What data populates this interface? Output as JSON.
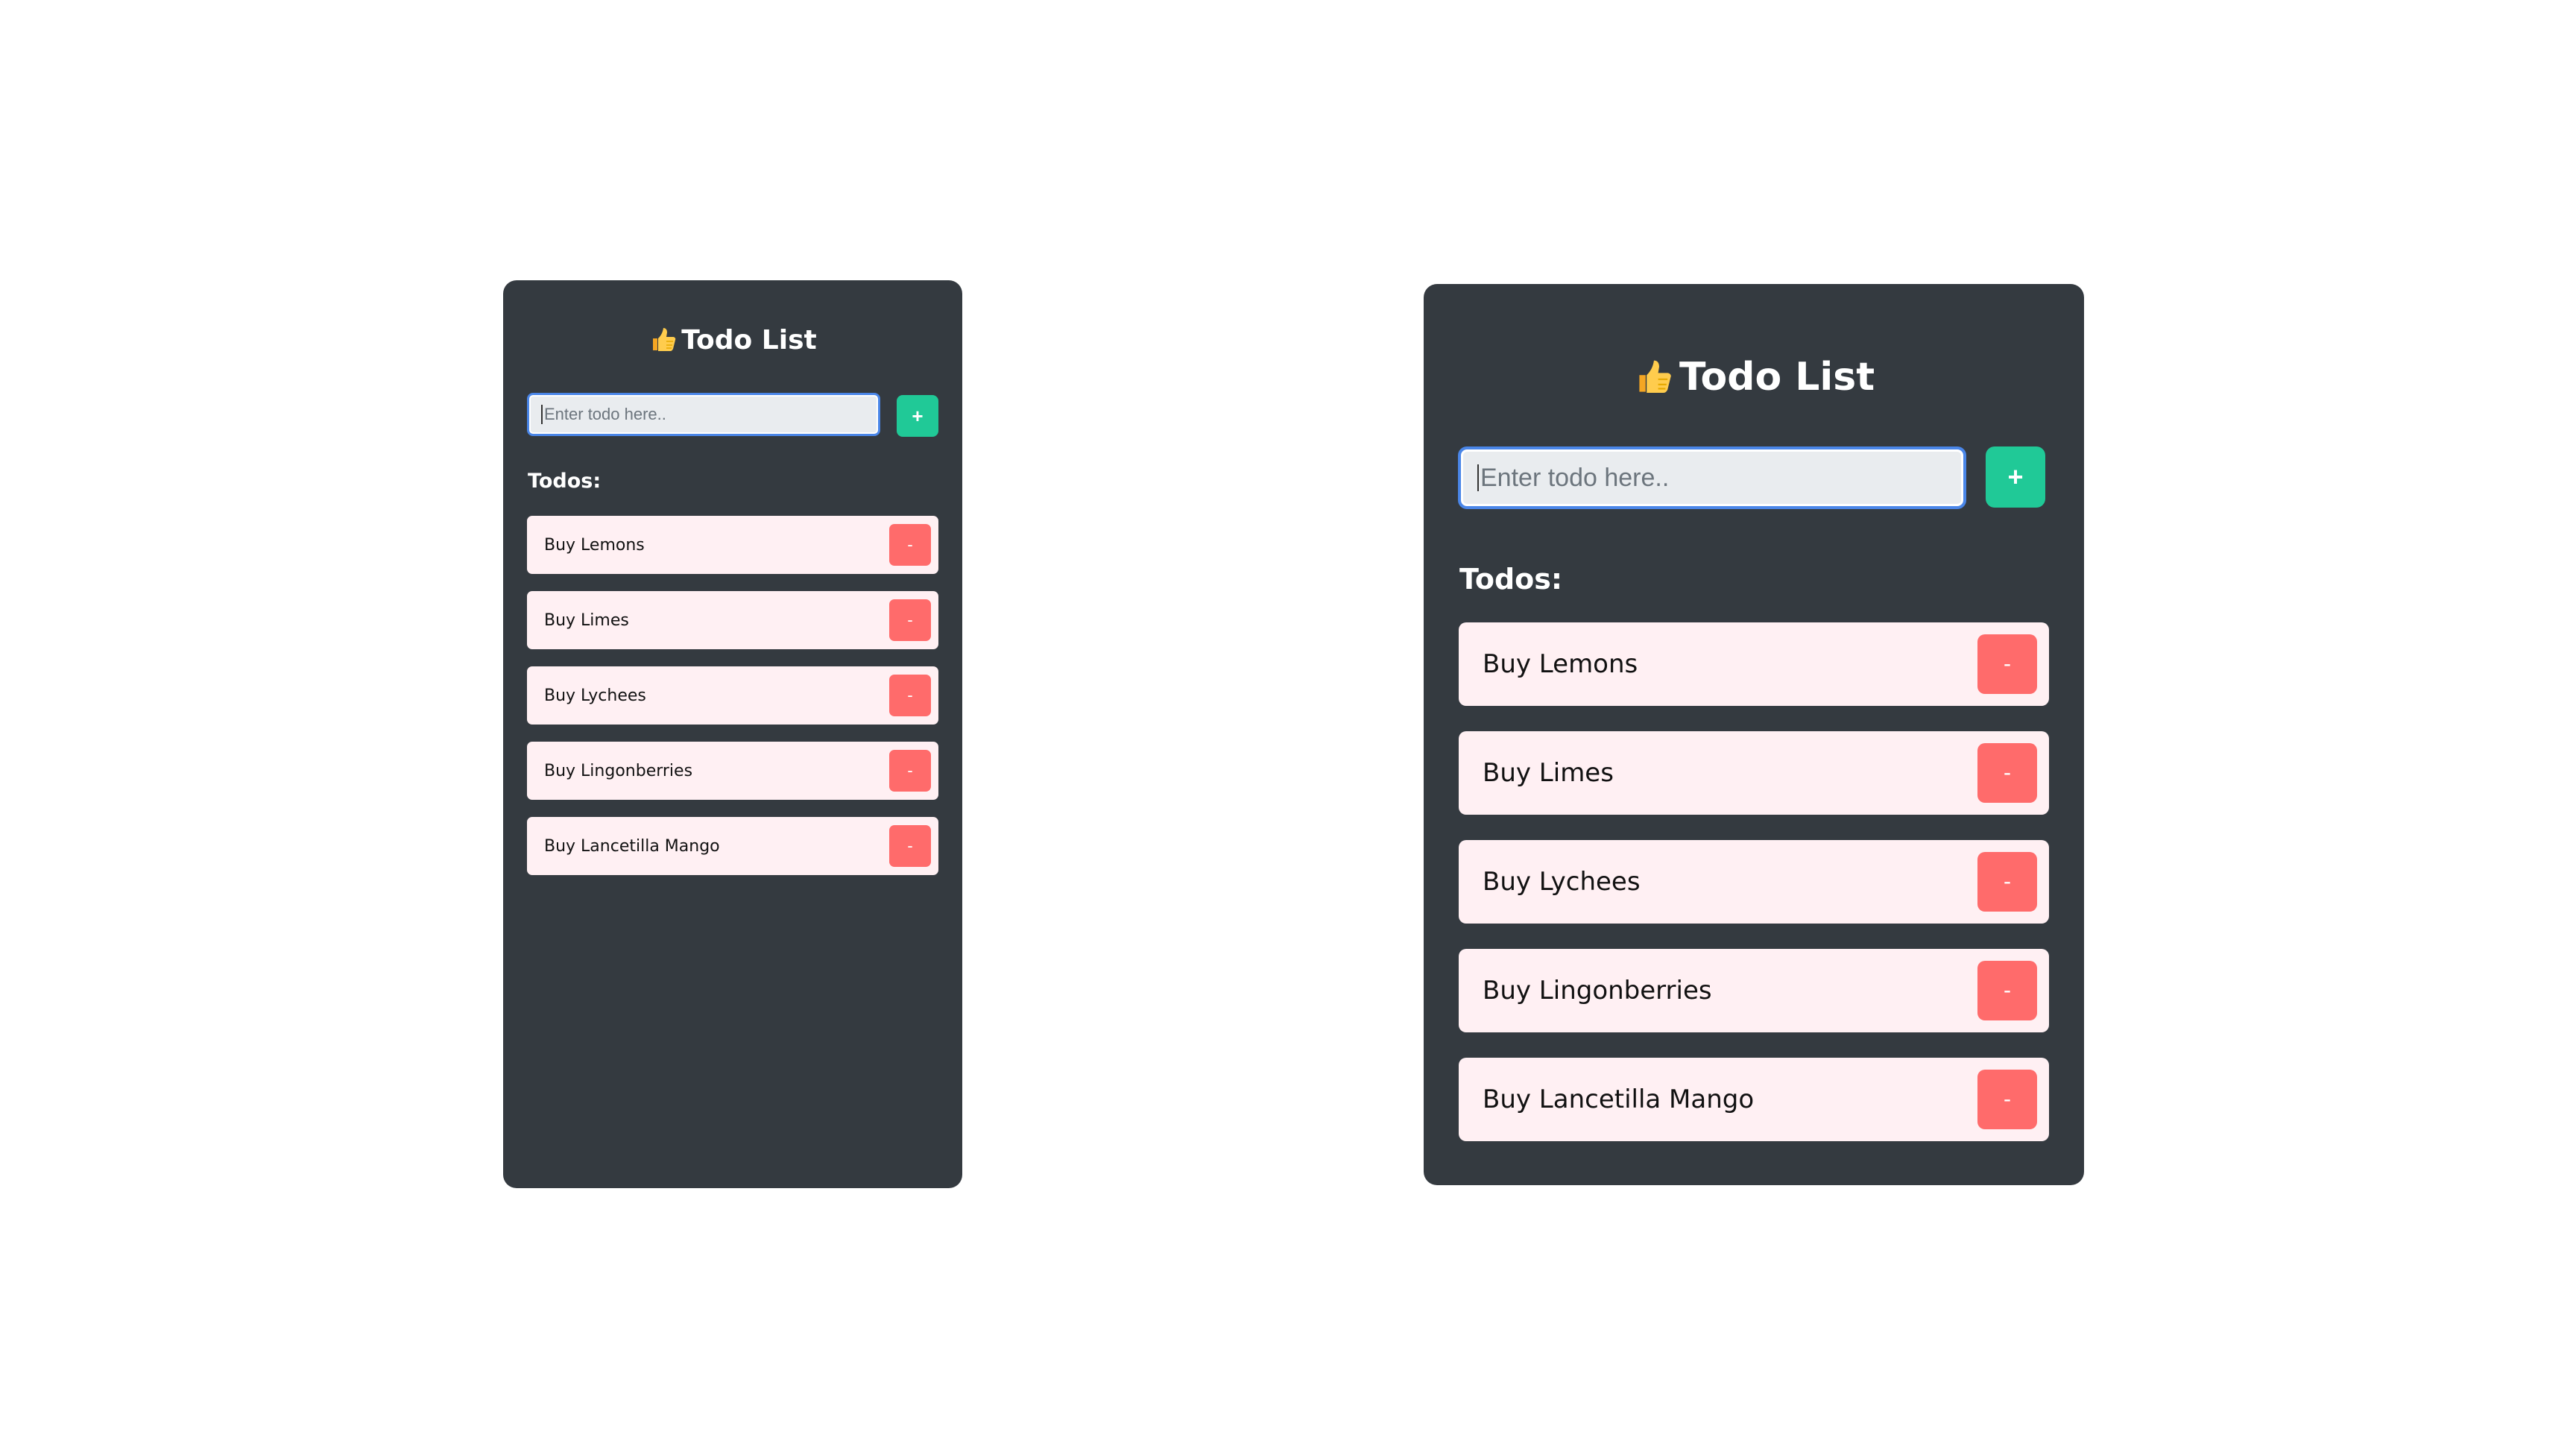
{
  "app": {
    "title": "Todo List",
    "title_icon": "thumbs-up-icon"
  },
  "form": {
    "placeholder": "Enter todo here..",
    "add_label": "+"
  },
  "todos_heading": "Todos:",
  "todos": [
    {
      "text": "Buy Lemons",
      "remove_label": "-"
    },
    {
      "text": "Buy Limes",
      "remove_label": "-"
    },
    {
      "text": "Buy Lychees",
      "remove_label": "-"
    },
    {
      "text": "Buy Lingonberries",
      "remove_label": "-"
    },
    {
      "text": "Buy Lancetilla Mango",
      "remove_label": "-"
    }
  ],
  "colors": {
    "card_bg": "#343a40",
    "input_bg": "#e9ecef",
    "focus_border": "#4a86e8",
    "add_button": "#20c997",
    "item_bg": "#fff0f3",
    "remove_button": "#ff6b6b"
  }
}
